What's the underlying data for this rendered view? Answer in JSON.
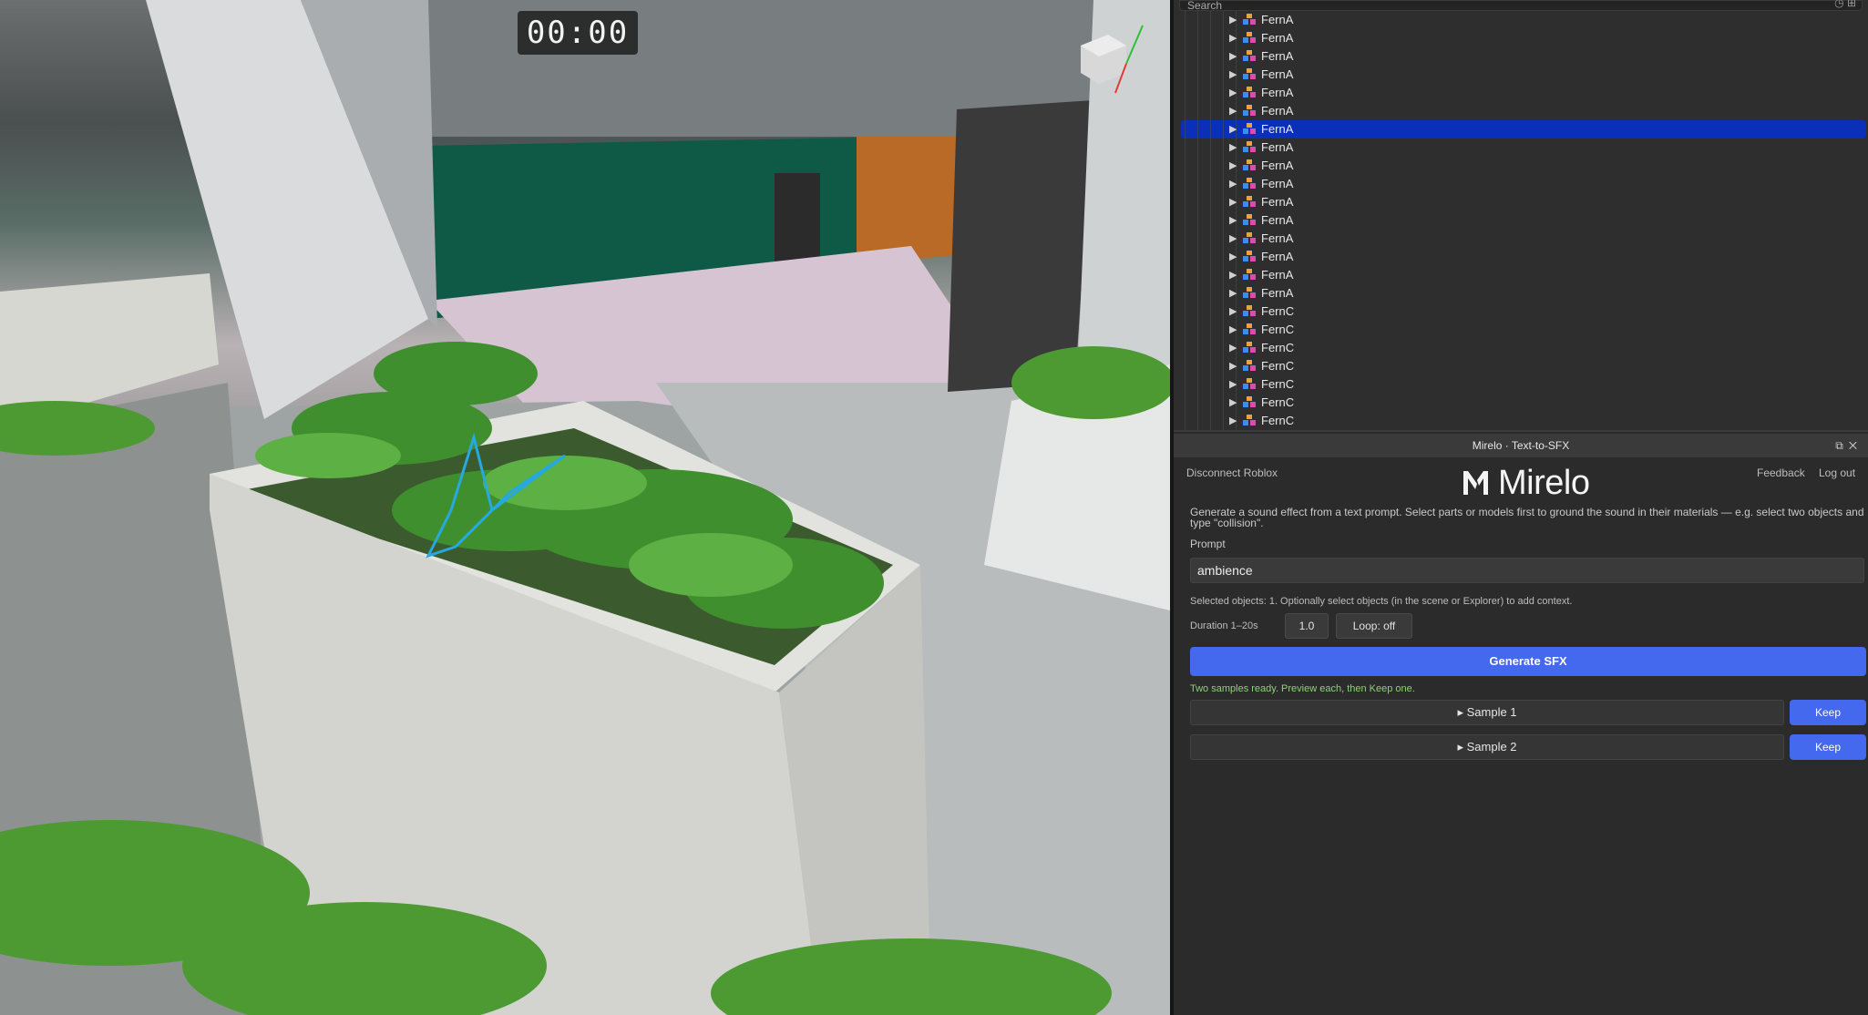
{
  "viewport": {
    "timer": "00:00"
  },
  "explorer": {
    "search_placeholder": "Search",
    "items": [
      {
        "label": "FernA"
      },
      {
        "label": "FernA"
      },
      {
        "label": "FernA"
      },
      {
        "label": "FernA"
      },
      {
        "label": "FernA"
      },
      {
        "label": "FernA"
      },
      {
        "label": "FernA",
        "selected": true
      },
      {
        "label": "FernA"
      },
      {
        "label": "FernA"
      },
      {
        "label": "FernA"
      },
      {
        "label": "FernA"
      },
      {
        "label": "FernA"
      },
      {
        "label": "FernA"
      },
      {
        "label": "FernA"
      },
      {
        "label": "FernA"
      },
      {
        "label": "FernA"
      },
      {
        "label": "FernC"
      },
      {
        "label": "FernC"
      },
      {
        "label": "FernC"
      },
      {
        "label": "FernC"
      },
      {
        "label": "FernC"
      },
      {
        "label": "FernC"
      },
      {
        "label": "FernC"
      }
    ]
  },
  "plugin": {
    "title": "Mirelo · Text-to-SFX",
    "disconnect_label": "Disconnect Roblox",
    "logo_text": "Mirelo",
    "feedback_label": "Feedback",
    "logout_label": "Log out",
    "description": "Generate a sound effect from a text prompt. Select parts or models first to ground the sound in their materials — e.g. select two objects and type \"collision\".",
    "prompt_label": "Prompt",
    "prompt_value": "ambience",
    "selected_note": "Selected objects: 1. Optionally select objects (in the scene or Explorer) to add context.",
    "duration_label": "Duration 1–20s",
    "duration_value": "1.0",
    "loop_label": "Loop: off",
    "generate_label": "Generate SFX",
    "status": "Two samples ready. Preview each, then Keep one.",
    "samples": [
      {
        "label": "▸ Sample 1",
        "keep_label": "Keep"
      },
      {
        "label": "▸ Sample 2",
        "keep_label": "Keep"
      }
    ]
  },
  "colors": {
    "accent": "#4468ee",
    "selection": "#0a2fb8",
    "status_green": "#8fd07a"
  }
}
